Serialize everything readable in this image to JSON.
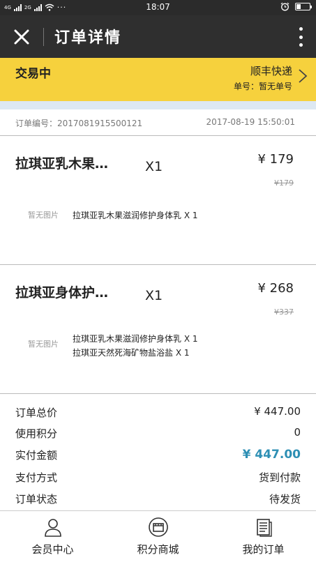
{
  "status_bar": {
    "network_1": "4G",
    "network_2": "2G",
    "time": "18:07"
  },
  "header": {
    "title": "订单详情",
    "close_icon": "close-icon",
    "more_icon": "more-vertical-icon"
  },
  "banner": {
    "status": "交易中",
    "courier": "顺丰快递",
    "tracking": "单号：暂无单号",
    "background": "#f6d13d"
  },
  "order": {
    "number": "订单编号：2017081915500121",
    "date": "2017-08-19 15:50:01"
  },
  "products": [
    {
      "name": "拉琪亚乳木果…",
      "qty": "X1",
      "price": "¥ 179",
      "original_price": "¥179",
      "no_image": "暂无图片",
      "items": [
        "拉琪亚乳木果滋润修护身体乳 X 1"
      ]
    },
    {
      "name": "拉琪亚身体护…",
      "qty": "X1",
      "price": "¥ 268",
      "original_price": "¥337",
      "no_image": "暂无图片",
      "items": [
        "拉琪亚乳木果滋润修护身体乳 X 1",
        "拉琪亚天然死海矿物盐浴盐 X 1"
      ]
    }
  ],
  "summary": [
    {
      "label": "订单总价",
      "value": "¥ 447.00"
    },
    {
      "label": "使用积分",
      "value": "0"
    },
    {
      "label": "实付金额",
      "value": "¥ 447.00"
    },
    {
      "label": "支付方式",
      "value": "货到付款"
    },
    {
      "label": "订单状态",
      "value": "待发货"
    }
  ],
  "accent_color": "#2d8fb4",
  "tabs": [
    {
      "label": "会员中心",
      "icon": "user-icon"
    },
    {
      "label": "积分商城",
      "icon": "store-icon"
    },
    {
      "label": "我的订单",
      "icon": "document-icon"
    }
  ]
}
